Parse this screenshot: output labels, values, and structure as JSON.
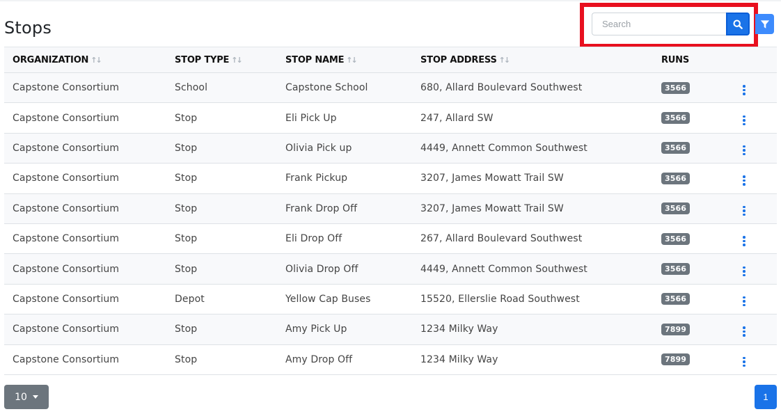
{
  "page": {
    "title": "Stops"
  },
  "search": {
    "placeholder": "Search",
    "value": ""
  },
  "table": {
    "headers": {
      "organization": "ORGANIZATION",
      "stop_type": "STOP TYPE",
      "stop_name": "STOP NAME",
      "stop_address": "STOP ADDRESS",
      "runs": "RUNS"
    },
    "sort_glyph": "↑↓",
    "rows": [
      {
        "organization": "Capstone Consortium",
        "stop_type": "School",
        "stop_name": "Capstone School",
        "stop_address": "680, Allard Boulevard Southwest",
        "runs": "3566"
      },
      {
        "organization": "Capstone Consortium",
        "stop_type": "Stop",
        "stop_name": "Eli Pick Up",
        "stop_address": "247, Allard SW",
        "runs": "3566"
      },
      {
        "organization": "Capstone Consortium",
        "stop_type": "Stop",
        "stop_name": "Olivia Pick up",
        "stop_address": "4449, Annett Common Southwest",
        "runs": "3566"
      },
      {
        "organization": "Capstone Consortium",
        "stop_type": "Stop",
        "stop_name": "Frank Pickup",
        "stop_address": "3207, James Mowatt Trail SW",
        "runs": "3566"
      },
      {
        "organization": "Capstone Consortium",
        "stop_type": "Stop",
        "stop_name": "Frank Drop Off",
        "stop_address": "3207, James Mowatt Trail SW",
        "runs": "3566"
      },
      {
        "organization": "Capstone Consortium",
        "stop_type": "Stop",
        "stop_name": "Eli Drop Off",
        "stop_address": "267, Allard Boulevard Southwest",
        "runs": "3566"
      },
      {
        "organization": "Capstone Consortium",
        "stop_type": "Stop",
        "stop_name": "Olivia Drop Off",
        "stop_address": "4449, Annett Common Southwest",
        "runs": "3566"
      },
      {
        "organization": "Capstone Consortium",
        "stop_type": "Depot",
        "stop_name": "Yellow Cap Buses",
        "stop_address": "15520, Ellerslie Road Southwest",
        "runs": "3566"
      },
      {
        "organization": "Capstone Consortium",
        "stop_type": "Stop",
        "stop_name": "Amy Pick Up",
        "stop_address": "1234 Milky Way",
        "runs": "7899"
      },
      {
        "organization": "Capstone Consortium",
        "stop_type": "Stop",
        "stop_name": "Amy Drop Off",
        "stop_address": "1234 Milky Way",
        "runs": "7899"
      }
    ]
  },
  "pagination": {
    "page_size": "10",
    "current_page": "1"
  },
  "icons": {
    "search": "search-icon",
    "filter": "filter-icon",
    "row_actions": "kebab-menu-icon",
    "page_size_caret": "caret-down-icon"
  },
  "colors": {
    "primary": "#1a73e8",
    "highlight": "#e8101f",
    "badge": "#6c757d"
  }
}
